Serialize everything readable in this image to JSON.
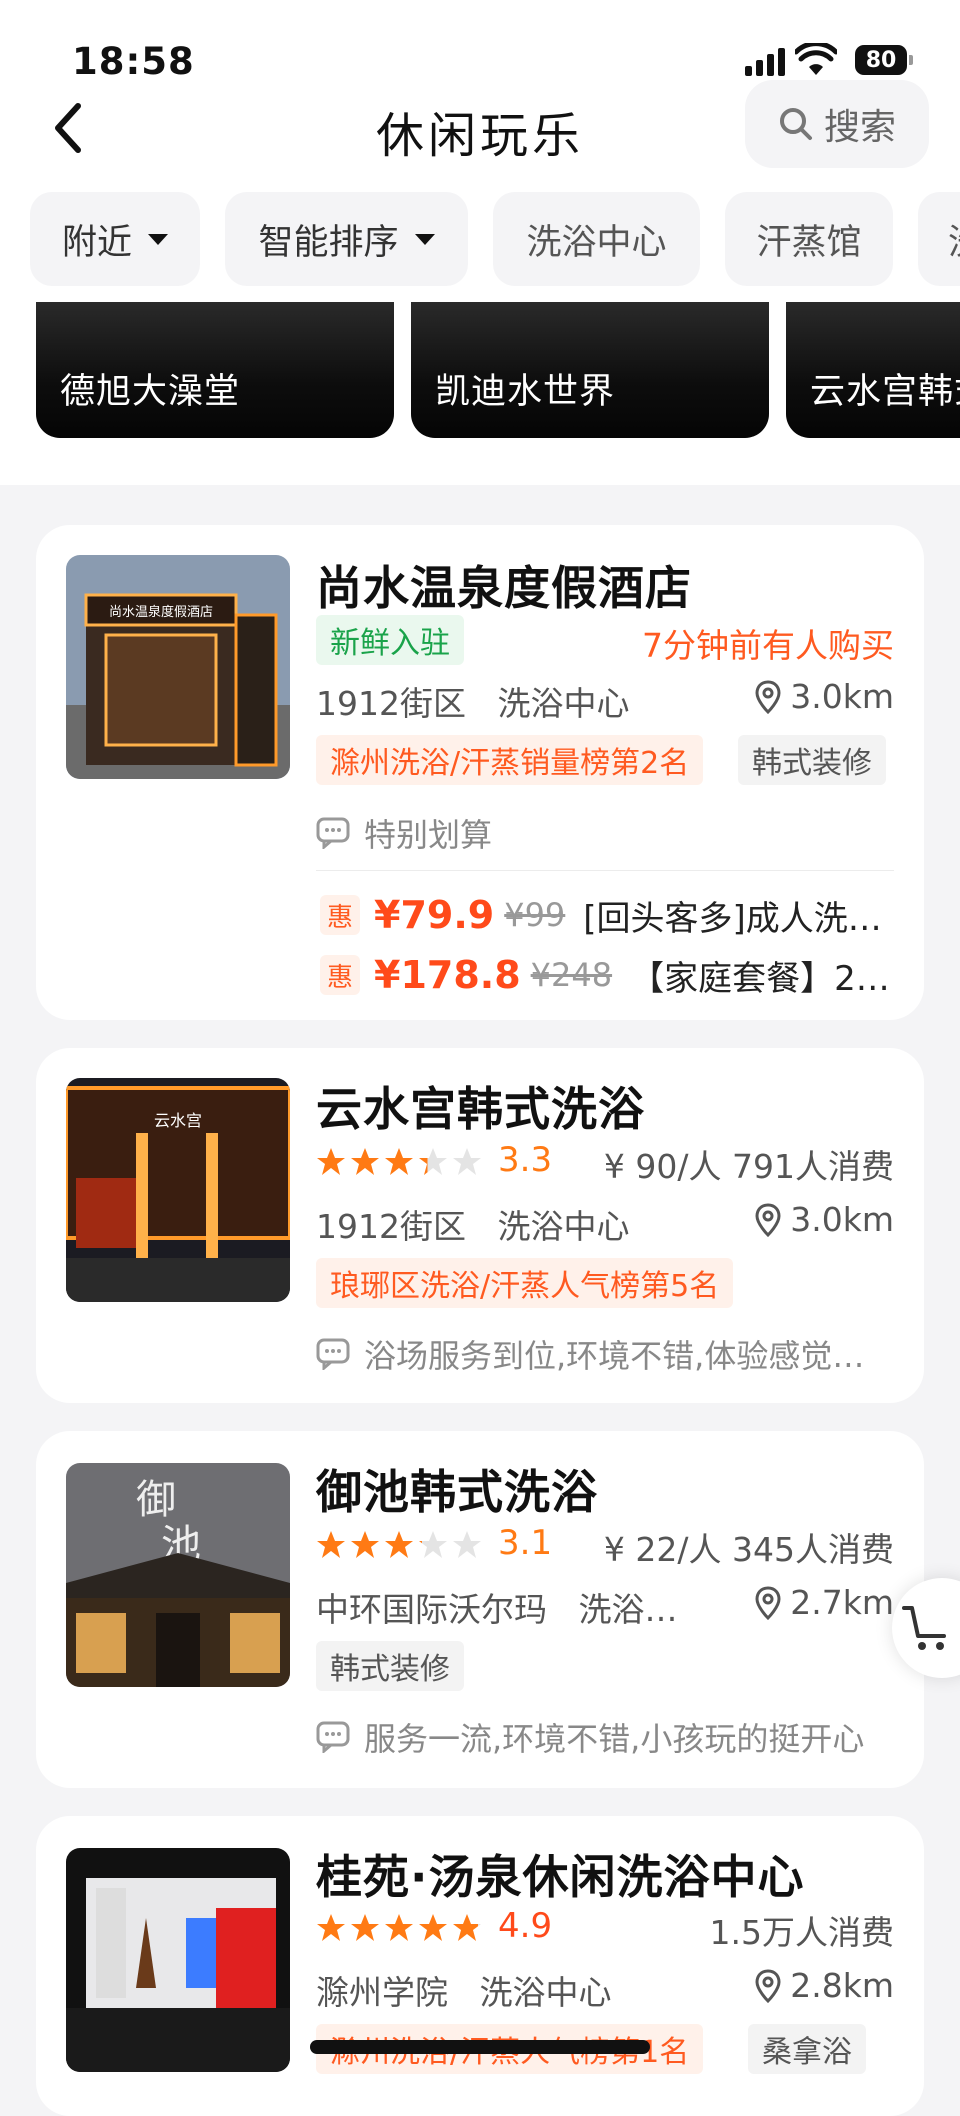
{
  "status": {
    "time": "18:58",
    "battery": "80"
  },
  "header": {
    "title": "休闲玩乐",
    "search_label": "搜索"
  },
  "filters": [
    "附近",
    "智能排序",
    "洗浴中心",
    "汗蒸馆",
    "洗"
  ],
  "banners": [
    "德旭大澡堂",
    "凯迪水世界",
    "云水宫韩式"
  ],
  "shops": [
    {
      "name": "尚水温泉度假酒店",
      "badge": "新鲜入驻",
      "recent": "7分钟前有人购买",
      "area": "1912街区",
      "category": "洗浴中心",
      "distance": "3.0km",
      "rank_tag": "滁州洗浴/汗蒸销量榜第2名",
      "feature_tag": "韩式装修",
      "review": "特别划算",
      "deals": [
        {
          "badge": "惠",
          "price": "¥79.9",
          "original": "¥99",
          "title": "[回头客多]成人洗…"
        },
        {
          "badge": "惠",
          "price": "¥178.8",
          "original": "¥248",
          "title": "【家庭套餐】2…"
        }
      ]
    },
    {
      "name": "云水宫韩式洗浴",
      "rating": 3.3,
      "score": "3.3",
      "per_person": "¥ 90/人",
      "consumers": "791人消费",
      "area": "1912街区",
      "category": "洗浴中心",
      "distance": "3.0km",
      "rank_tag": "琅琊区洗浴/汗蒸人气榜第5名",
      "review": "浴场服务到位,环境不错,体验感觉…"
    },
    {
      "name": "御池韩式洗浴",
      "rating": 3.1,
      "score": "3.1",
      "per_person": "¥ 22/人",
      "consumers": "345人消费",
      "area": "中环国际沃尔玛",
      "category": "洗浴…",
      "distance": "2.7km",
      "feature_tag": "韩式装修",
      "review": "服务一流,环境不错,小孩玩的挺开心"
    },
    {
      "name": "桂苑·汤泉休闲洗浴中心",
      "rating": 4.9,
      "score": "4.9",
      "consumers": "1.5万人消费",
      "area": "滁州学院",
      "category": "洗浴中心",
      "distance": "2.8km",
      "rank_tag": "滁州洗浴/汗蒸人气榜第1名",
      "feature_tag": "桑拿浴"
    }
  ],
  "colors": {
    "accent": "#ff5a20",
    "star": "#ff7a14",
    "green": "#1aa34a"
  }
}
